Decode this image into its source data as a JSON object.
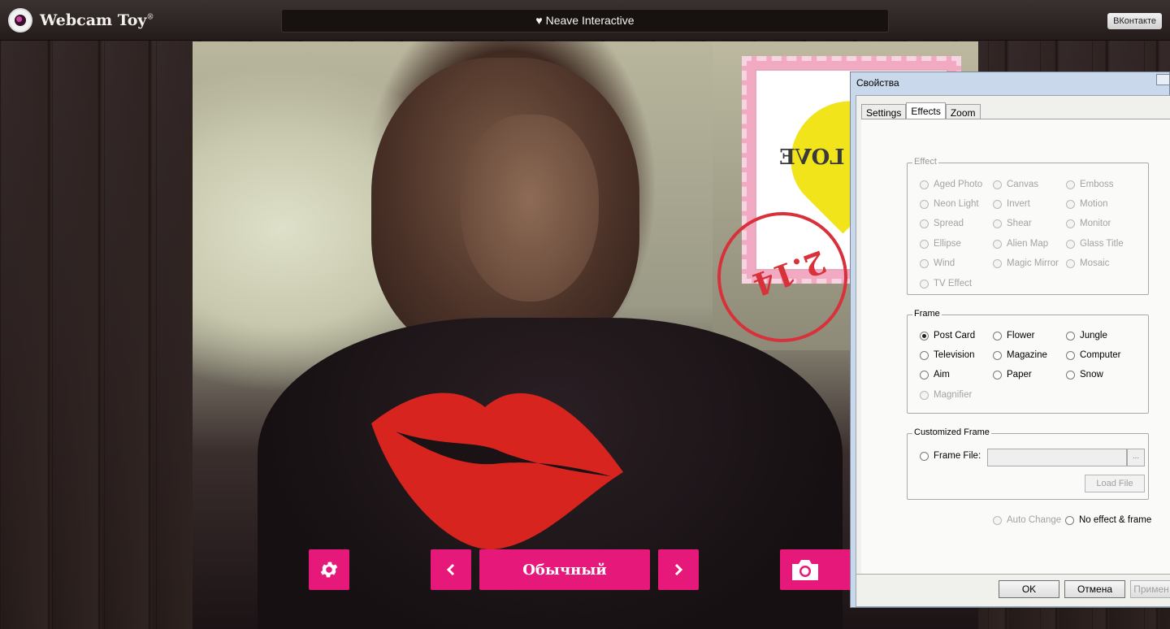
{
  "app": {
    "logo_text": "Webcam Toy",
    "logo_mark": "®",
    "credit": "♥  Neave Interactive",
    "vk_button": "ВКонтакте"
  },
  "camera": {
    "stamp_text": "LOVE",
    "postmark_text": "2.14",
    "controls": {
      "settings_icon": "gear-icon",
      "prev_icon": "chevron-left-icon",
      "effect_name": "Обычный",
      "next_icon": "chevron-right-icon",
      "snap_icon": "camera-icon"
    },
    "accent_color": "#e6197a"
  },
  "dialog": {
    "title": "Свойства",
    "tabs": [
      "Settings",
      "Effects",
      "Zoom"
    ],
    "active_tab": "Effects",
    "effect_group": {
      "legend": "Effect",
      "options": [
        [
          "Aged Photo",
          "Canvas",
          "Emboss"
        ],
        [
          "Neon Light",
          "Invert",
          "Motion"
        ],
        [
          "Spread",
          "Shear",
          "Monitor"
        ],
        [
          "Ellipse",
          "Alien Map",
          "Glass Title"
        ],
        [
          "Wind",
          "Magic Mirror",
          "Mosaic"
        ],
        [
          "TV Effect"
        ]
      ]
    },
    "frame_group": {
      "legend": "Frame",
      "selected": "Post Card",
      "options": [
        [
          "Post Card",
          "Flower",
          "Jungle"
        ],
        [
          "Television",
          "Magazine",
          "Computer"
        ],
        [
          "Aim",
          "Paper",
          "Snow"
        ],
        [
          "Magnifier"
        ]
      ]
    },
    "custom_frame": {
      "legend": "Customized Frame",
      "frame_file_label": "Frame File:",
      "frame_file_value": "",
      "browse_label": "...",
      "load_label": "Load File"
    },
    "auto_change": "Auto Change",
    "no_effect": "No effect & frame",
    "buttons": {
      "ok": "OK",
      "cancel": "Отмена",
      "apply": "Примен"
    }
  }
}
